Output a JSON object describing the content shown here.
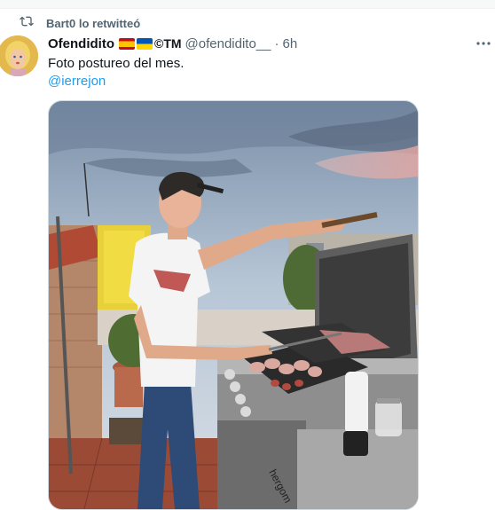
{
  "retweet": {
    "icon": "retweet-icon",
    "text": "Bart0 lo retwitteó"
  },
  "author": {
    "display_name": "Ofendidito",
    "flags": [
      "spain-flag",
      "ukraine-flag"
    ],
    "name_suffix": "©TM",
    "handle": "@ofendidito__",
    "separator": "·",
    "time": "6h"
  },
  "tweet": {
    "text": "Foto postureo del mes.",
    "mention": "@ierrejon"
  },
  "media": {
    "alt": "photo-man-grilling-on-terrace",
    "grill_brand": "hergom"
  },
  "colors": {
    "link": "#1d9bf0",
    "secondary": "#536471",
    "text": "#0f1419"
  }
}
